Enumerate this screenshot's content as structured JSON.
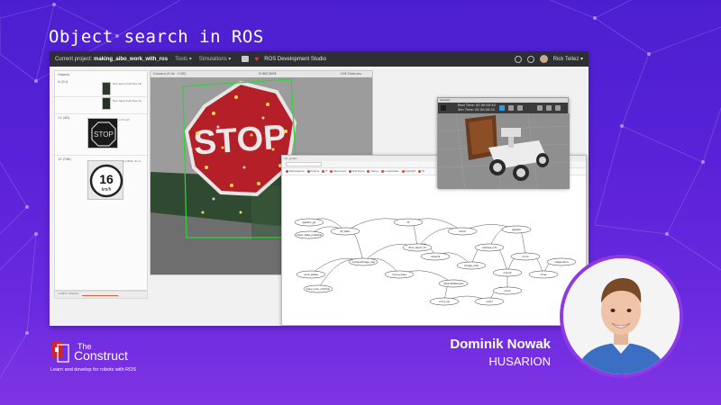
{
  "slide": {
    "title": "Object search in ROS"
  },
  "ide": {
    "current_project_label": "Current project:",
    "project_name": "making_aibo_work_with_ros",
    "menu_tools": "Tools ▾",
    "menu_simulations": "Simulations ▾",
    "app_name": "ROS Development Studio",
    "user_name": "Rick Tellez ▾"
  },
  "object_panel": {
    "header": "Objects",
    "rows": [
      {
        "label": "4 (O:I)",
        "info": "Two bare matches (4)"
      },
      {
        "label": "",
        "info": "Two bare matches (5)"
      },
      {
        "label": "11 (4D)",
        "info": "13 to 13 out"
      },
      {
        "label": "13 (T48)",
        "info": "Two bare (often 4x 4-hole)"
      }
    ],
    "stop_thumb_text": "STOP",
    "speed_thumb_number": "16",
    "speed_thumb_unit": "km/h",
    "footer": "confirm objects"
  },
  "camera": {
    "header": "Camera (5 Hz · 0:00)",
    "mid": "SUBSCRIBE",
    "right": "CHK Features",
    "sign_text": "STOP"
  },
  "gazebo": {
    "title": "Gazebo",
    "real_time": "Real Time: 00 00:00:45",
    "sim_time": "Sim Time: 00 00:00:32"
  },
  "graph": {
    "title": "rqt_graph",
    "filters": [
      "Namespaces",
      "Actions",
      "tf",
      "dead sinks",
      "leaf topics",
      "debug",
      "unreachable",
      "highlight",
      "fit"
    ],
    "nodes": [
      "/gazebo_gui",
      "/robot_state_publisher",
      "/tf_static",
      "/tf",
      "/camera/image_raw",
      "/find_object_2d",
      "/objects",
      "/image_view",
      "/camera_info",
      "/gazebo",
      "/clock",
      "/rosout",
      "/joint_states",
      "/cmd_vel",
      "/move_base",
      "/odom",
      "/scan",
      "/objectsStamped",
      "/laser_scan_matcher",
      "/map",
      "/amcl",
      "/diagnostics"
    ]
  },
  "presenter": {
    "name": "Dominik Nowak",
    "company": "HUSARION"
  },
  "brand": {
    "the": "The",
    "name": "Construct",
    "tagline": "Learn and develop for robots with ROS"
  },
  "colors": {
    "background_top": "#4b1fd0",
    "background_bottom": "#7f34e4",
    "ide_bar": "#2d2f33",
    "stop_red": "#c0262c",
    "selection_green": "#27c93f",
    "avatar_ring": "#8d3ae6"
  }
}
